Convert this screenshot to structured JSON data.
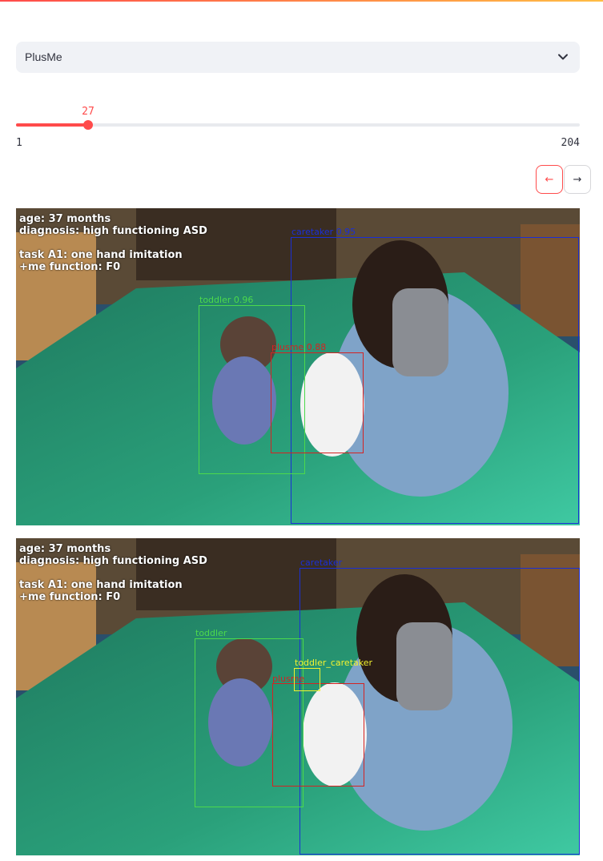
{
  "select": {
    "value": "PlusMe",
    "icon": "chevron-down-icon"
  },
  "slider": {
    "current": "27",
    "min": "1",
    "max": "204",
    "value": 27,
    "range": [
      1,
      204
    ]
  },
  "nav": {
    "prev_icon": "←",
    "next_icon": "→"
  },
  "frames": [
    {
      "info": {
        "age": "age: 37 months",
        "diagnosis": "diagnosis: high functioning ASD",
        "task": "task A1: one hand imitation",
        "function": "+me function: F0"
      },
      "detections": {
        "caretaker": "caretaker 0.95",
        "toddler": "toddler 0.96",
        "plusme": "plusme 0.88"
      }
    },
    {
      "info": {
        "age": "age: 37 months",
        "diagnosis": "diagnosis: high functioning ASD",
        "task": "task A1: one hand imitation",
        "function": "+me function: F0"
      },
      "detections": {
        "caretaker": "caretaker",
        "toddler": "toddler",
        "toddler_caretaker": "toddler_caretaker",
        "plusme": "plusme"
      }
    }
  ],
  "colors": {
    "accent": "#ff4b4b",
    "caretaker_box": "#1a2fd6",
    "toddler_box": "#4cd94c",
    "plusme_box": "#d42323",
    "interaction_box": "#f2f230"
  }
}
